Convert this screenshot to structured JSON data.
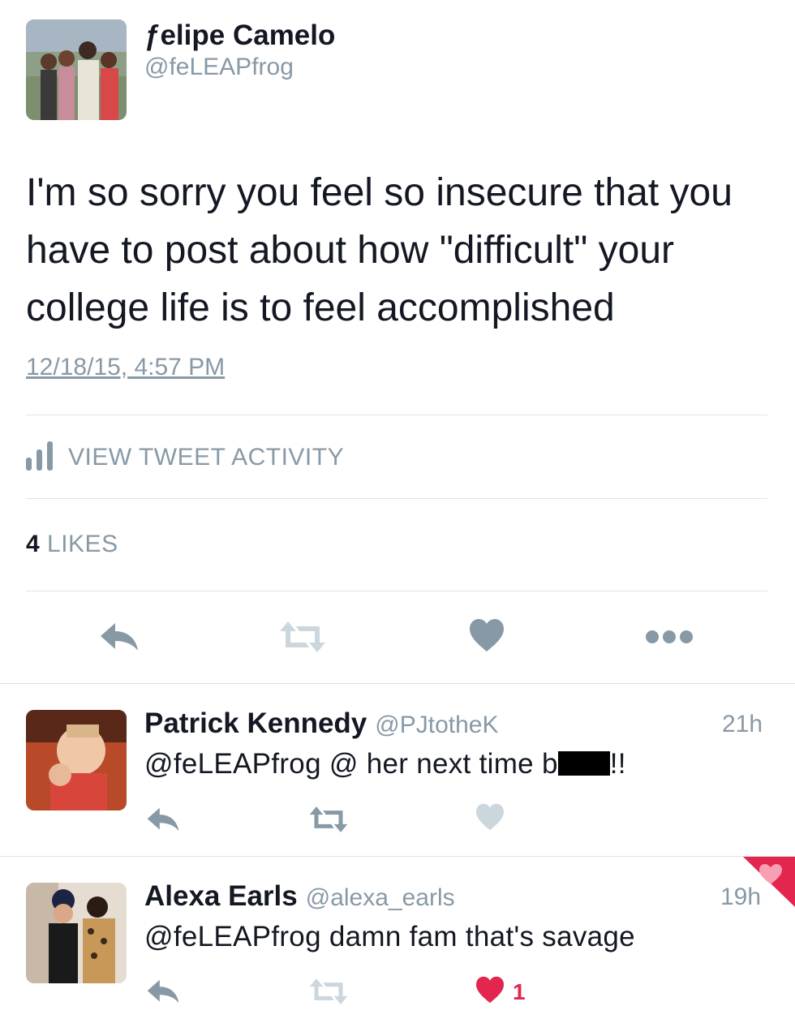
{
  "main_tweet": {
    "author_name": "ƒelipe Camelo",
    "author_handle": "@feLEAPfrog",
    "text": "I'm so sorry you feel so insecure that you have to post about how \"difficult\" your college life is to feel accomplished",
    "timestamp": "12/18/15, 4:57 PM",
    "activity_label": "VIEW TWEET ACTIVITY",
    "likes_count": "4",
    "likes_label": "LIKES"
  },
  "actions": {
    "reply": "reply-icon",
    "retweet": "retweet-icon",
    "like": "heart-icon",
    "more": "more-dots-icon"
  },
  "replies": [
    {
      "name": "Patrick Kennedy",
      "handle": "@PJtotheK",
      "time": "21h",
      "text_before": "@feLEAPfrog @ her next time b",
      "text_after": "!!",
      "liked": false
    },
    {
      "name": "Alexa Earls",
      "handle": "@alexa_earls",
      "time": "19h",
      "text": "@feLEAPfrog damn fam that's savage",
      "liked": true,
      "like_count": "1"
    }
  ],
  "colors": {
    "text": "#141823",
    "muted": "#8899a6",
    "divider": "#dfe3e7",
    "like_red": "#e2264d"
  }
}
